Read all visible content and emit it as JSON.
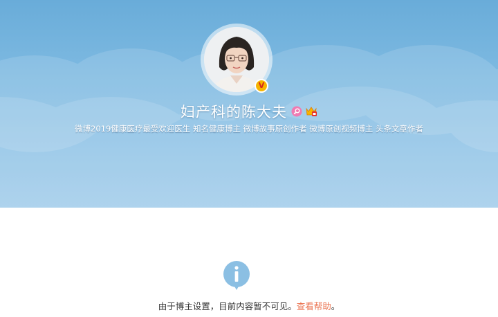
{
  "profile": {
    "name": "妇产科的陈大夫",
    "description": "微博2019健康医疗最受欢迎医生 知名健康博主 微博故事原创作者 微博原创视频博主 头条文章作者",
    "verified_badge": "V",
    "icons": {
      "verified": "verified-v-icon",
      "gender": "female-icon",
      "member": "member-icon"
    }
  },
  "notice": {
    "text": "由于博主设置，目前内容暂不可见。",
    "help_link": "查看帮助",
    "end_punct": "。",
    "icon": "info-icon"
  },
  "colors": {
    "banner_top": "#69acd9",
    "banner_bottom": "#a3cdeb",
    "info_icon": "#8bbfe3",
    "link": "#eb7350",
    "text": "#333333",
    "female_badge": "#f07bb2"
  }
}
